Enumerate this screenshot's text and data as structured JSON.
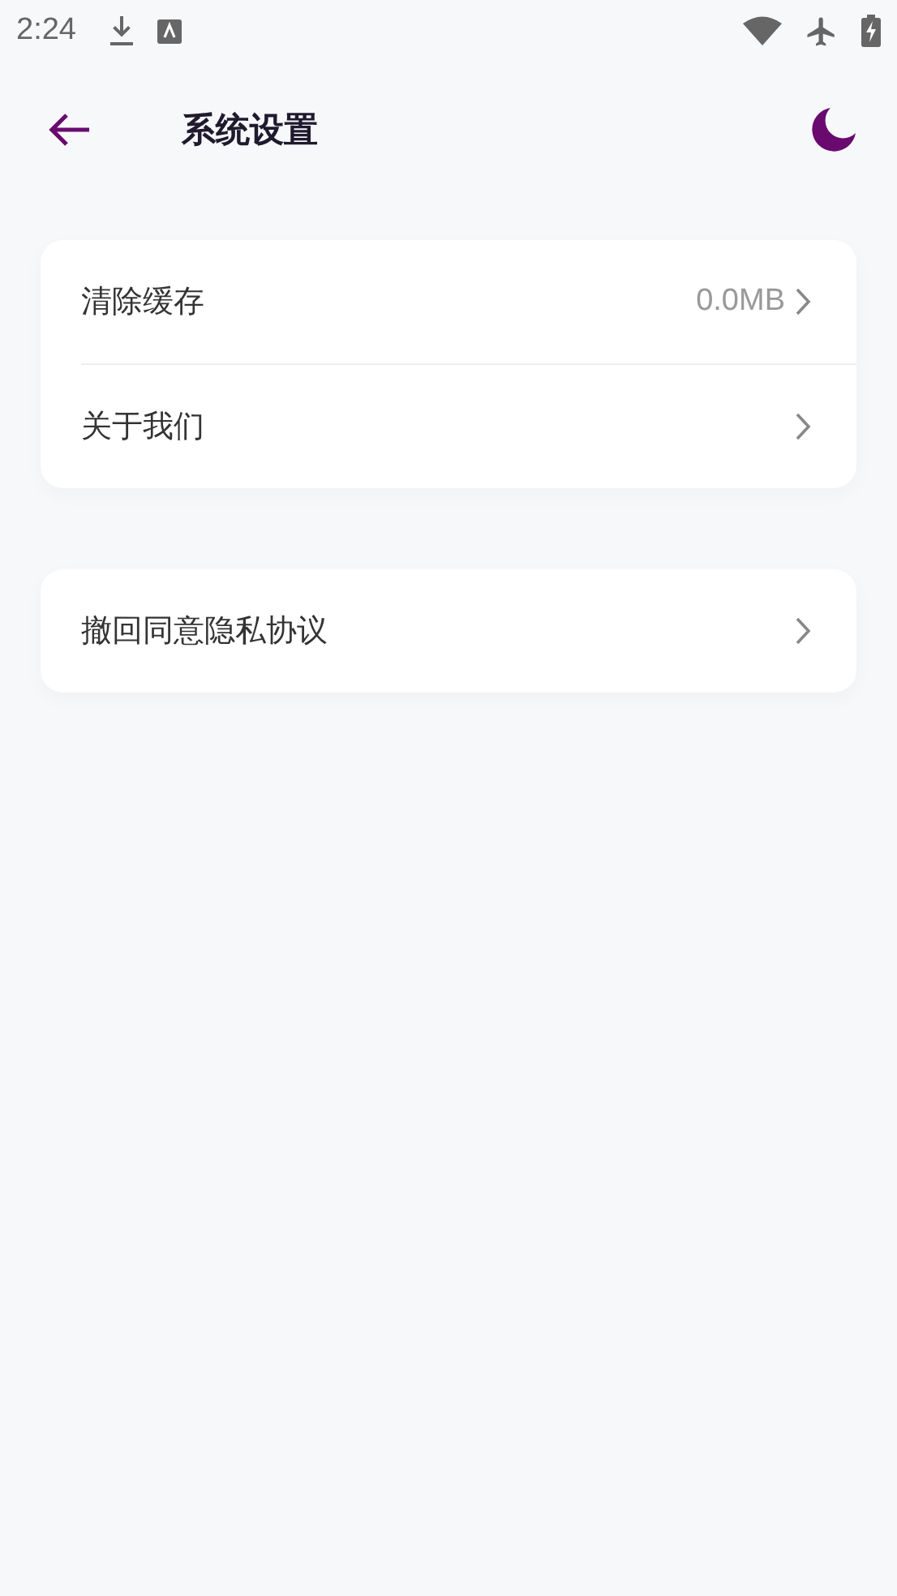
{
  "status_bar": {
    "time": "2:24"
  },
  "header": {
    "title": "系统设置"
  },
  "groups": [
    {
      "items": [
        {
          "label": "清除缓存",
          "value": "0.0MB"
        },
        {
          "label": "关于我们"
        }
      ]
    },
    {
      "items": [
        {
          "label": "撤回同意隐私协议"
        }
      ]
    }
  ]
}
